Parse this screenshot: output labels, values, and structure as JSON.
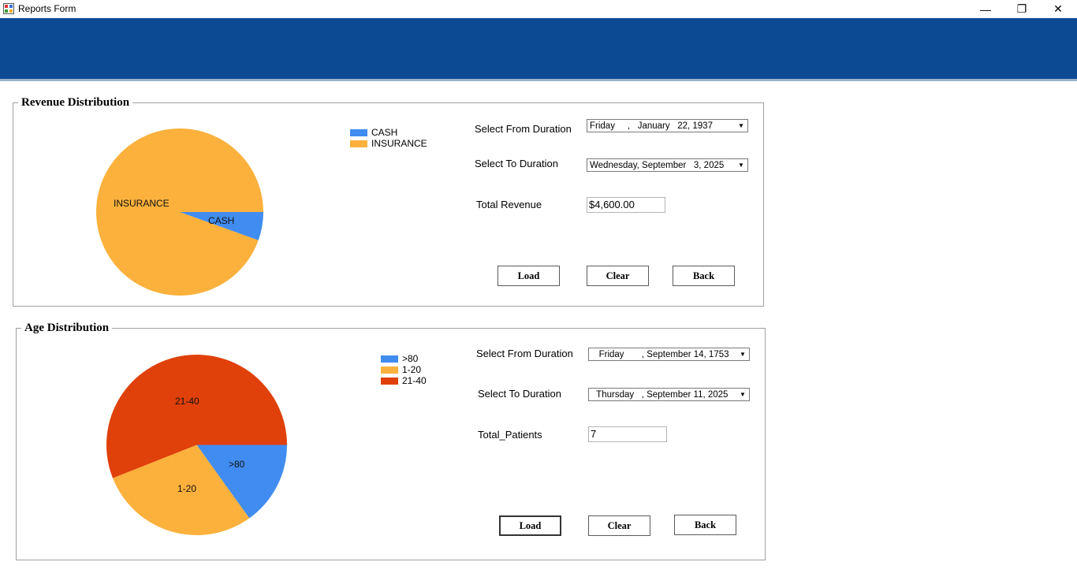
{
  "window": {
    "title": "Reports Form",
    "minimize": "—",
    "restore": "❐",
    "close": "✕"
  },
  "revenue": {
    "group_title": "Revenue Distribution",
    "chart_data": {
      "type": "pie",
      "slices": [
        {
          "label": "INSURANCE",
          "value": 94.5,
          "color": "#fbb13c"
        },
        {
          "label": "CASH",
          "value": 5.5,
          "color": "#418cf0"
        }
      ]
    },
    "legend": [
      {
        "label": "CASH",
        "color": "#418cf0"
      },
      {
        "label": "INSURANCE",
        "color": "#fbb13c"
      }
    ],
    "from_label": "Select From Duration",
    "from_value": "Friday     ,   January   22, 1937",
    "to_label": "Select To Duration",
    "to_value": "Wednesday, September   3, 2025",
    "total_label": "Total Revenue",
    "total_value": "$4,600.00",
    "load_label": "Load",
    "clear_label": "Clear",
    "back_label": "Back"
  },
  "age": {
    "group_title": "Age Distribution",
    "chart_data": {
      "type": "pie",
      "slices": [
        {
          "label": ">80",
          "value": 15.1,
          "color": "#418cf0"
        },
        {
          "label": "1-20",
          "value": 28.9,
          "color": "#fbb13c"
        },
        {
          "label": "21-40",
          "value": 56.0,
          "color": "#e0400a"
        }
      ]
    },
    "legend": [
      {
        "label": ">80",
        "color": "#418cf0"
      },
      {
        "label": "1-20",
        "color": "#fbb13c"
      },
      {
        "label": "21-40",
        "color": "#e0400a"
      }
    ],
    "from_label": "Select From Duration",
    "from_value": "   Friday       , September 14, 1753",
    "to_label": "Select To Duration",
    "to_value": "  Thursday   , September 11, 2025",
    "total_label": "Total_Patients",
    "total_value": "7",
    "load_label": "Load",
    "clear_label": "Clear",
    "back_label": "Back"
  }
}
